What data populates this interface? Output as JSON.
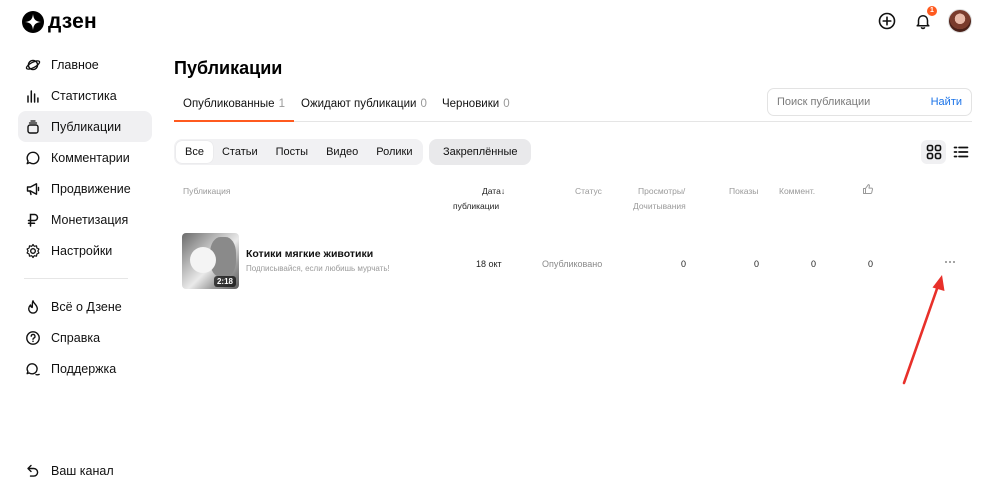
{
  "brand": {
    "name": "дзен"
  },
  "header": {
    "icons": [
      "plus-square-icon",
      "bell-icon",
      "avatar"
    ],
    "notification_count": "1"
  },
  "sidebar": {
    "items": [
      {
        "label": "Главное",
        "icon": "planet-icon"
      },
      {
        "label": "Статистика",
        "icon": "bar-chart-icon"
      },
      {
        "label": "Публикации",
        "icon": "stack-icon",
        "active": true
      },
      {
        "label": "Комментарии",
        "icon": "comment-icon"
      },
      {
        "label": "Продвижение",
        "icon": "megaphone-icon"
      },
      {
        "label": "Монетизация",
        "icon": "ruble-icon"
      },
      {
        "label": "Настройки",
        "icon": "gear-icon"
      }
    ],
    "secondary": [
      {
        "label": "Всё о Дзене",
        "icon": "flame-icon"
      },
      {
        "label": "Справка",
        "icon": "question-icon"
      },
      {
        "label": "Поддержка",
        "icon": "chat-icon"
      }
    ],
    "footer": {
      "label": "Ваш канал",
      "icon": "back-arrow-icon"
    }
  },
  "main": {
    "title": "Публикации",
    "tabs": [
      {
        "label": "Опубликованные",
        "count": "1",
        "active": true
      },
      {
        "label": "Ожидают публикации",
        "count": "0"
      },
      {
        "label": "Черновики",
        "count": "0"
      }
    ],
    "search": {
      "placeholder": "Поиск публикации",
      "button": "Найти"
    },
    "filters": [
      "Все",
      "Статьи",
      "Посты",
      "Видео",
      "Ролики"
    ],
    "active_filter": "Все",
    "pinned": "Закреплённые",
    "columns": {
      "publication": "Публикация",
      "date": "Дата↓",
      "date2": "публикации",
      "status": "Статус",
      "views": "Просмотры/",
      "views2": "Дочитывания",
      "impressions": "Показы",
      "comments": "Коммент."
    },
    "rows": [
      {
        "title": "Котики мягкие животики",
        "subtitle": "Подписывайся, если любишь мурчать!",
        "duration": "2:18",
        "date": "18 окт",
        "status": "Опубликовано",
        "views": "0",
        "impressions": "0",
        "comments": "0",
        "likes": "0"
      }
    ]
  },
  "colors": {
    "accent": "#ff5a1f",
    "link": "#1a73e8",
    "annotation_arrow": "#e8302a"
  }
}
